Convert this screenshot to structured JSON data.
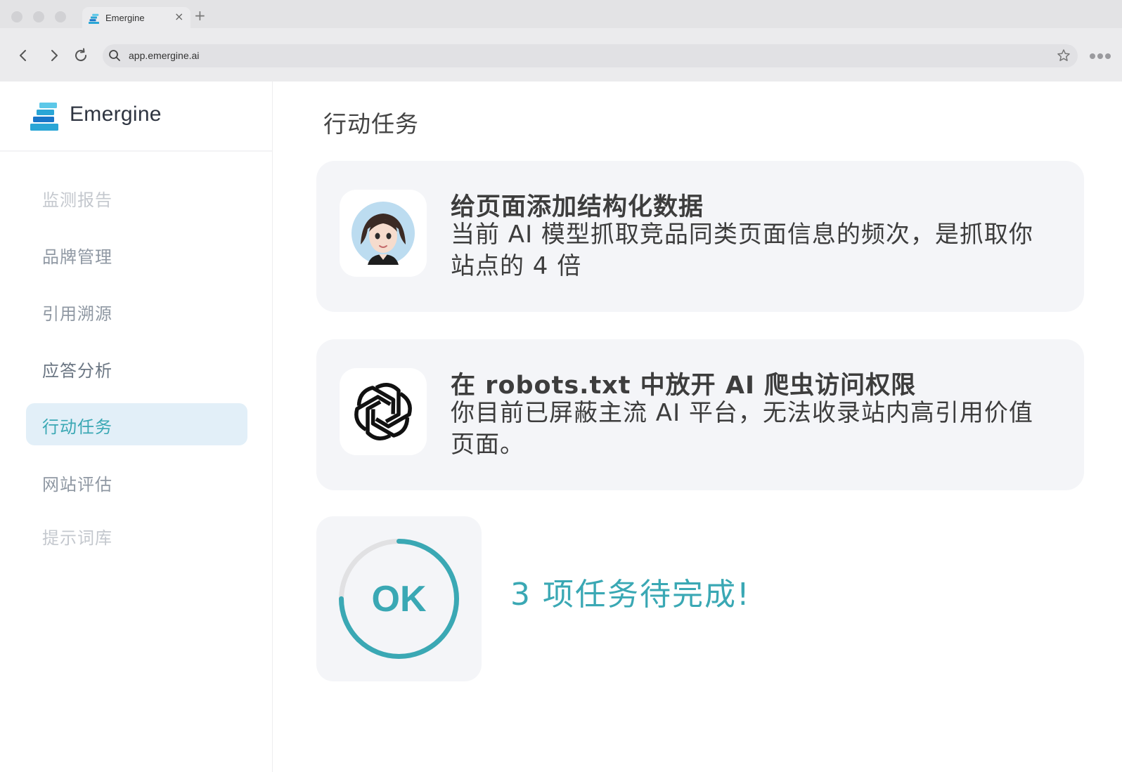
{
  "browser": {
    "tab_title": "Emergine",
    "tab_close": "×",
    "new_tab": "+",
    "url": "app.emergine.ai"
  },
  "brand": {
    "name": "Emergine",
    "accent": "#3aa8b4",
    "logo_colors": [
      "#2aa6d6",
      "#1976c8",
      "#5cc8e8"
    ]
  },
  "sidebar": {
    "items": [
      {
        "label": "监测报告",
        "color": "#c4c8ce",
        "active": false
      },
      {
        "label": "品牌管理",
        "color": "#8f98a3",
        "active": false
      },
      {
        "label": "引用溯源",
        "color": "#8f98a3",
        "active": false
      },
      {
        "label": "应答分析",
        "color": "#6b7683",
        "active": false
      },
      {
        "label": "行动任务",
        "color": "#3aa8b4",
        "active": true
      },
      {
        "label": "网站评估",
        "color": "#8f98a3",
        "active": false
      },
      {
        "label": "提示词库",
        "color": "#c4c8ce",
        "active": false
      }
    ]
  },
  "main": {
    "title": "行动任务",
    "tasks": [
      {
        "icon": "avatar-icon",
        "title": "给页面添加结构化数据",
        "description": "当前 AI 模型抓取竞品同类页面信息的频次，是抓取你站点的 4 倍"
      },
      {
        "icon": "openai-logo-icon",
        "title": "在 robots.txt 中放开 AI 爬虫访问权限",
        "description": "你目前已屏蔽主流 AI 平台，无法收录站内高引用价值页面。"
      }
    ],
    "status": {
      "badge": "OK",
      "progress": 0.75,
      "message": "3 项任务待完成!"
    }
  }
}
